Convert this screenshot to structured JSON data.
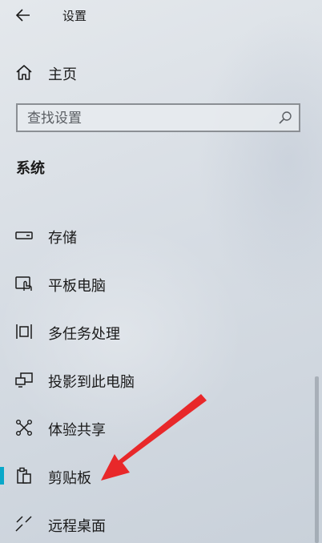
{
  "window": {
    "title": "设置"
  },
  "home": {
    "label": "主页",
    "icon": "home-icon"
  },
  "search": {
    "placeholder": "查找设置",
    "value": "",
    "icon": "search-icon"
  },
  "section": {
    "title": "系统"
  },
  "nav": {
    "items": [
      {
        "label": "存储",
        "icon": "storage-icon"
      },
      {
        "label": "平板电脑",
        "icon": "tablet-icon"
      },
      {
        "label": "多任务处理",
        "icon": "multitasking-icon"
      },
      {
        "label": "投影到此电脑",
        "icon": "project-icon"
      },
      {
        "label": "体验共享",
        "icon": "shared-experiences-icon"
      },
      {
        "label": "剪贴板",
        "icon": "clipboard-icon",
        "selected": true
      },
      {
        "label": "远程桌面",
        "icon": "remote-desktop-icon"
      }
    ]
  },
  "colors": {
    "accent": "#0aa8c9",
    "annotation_arrow": "#e8282a"
  }
}
